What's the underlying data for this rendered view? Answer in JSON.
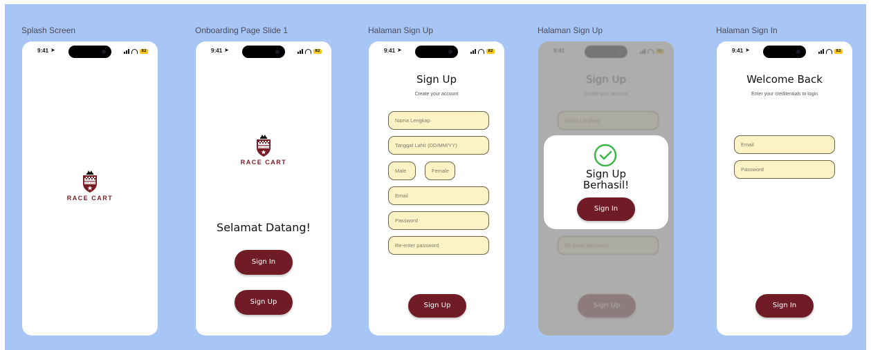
{
  "frames": [
    {
      "label": "Splash Screen"
    },
    {
      "label": "Onboarding Page Slide 1"
    },
    {
      "label": "Halaman Sign Up"
    },
    {
      "label": "Halaman Sign Up"
    },
    {
      "label": "Halaman Sign In"
    }
  ],
  "status_bar": {
    "time": "9:41",
    "battery": "82"
  },
  "logo": {
    "badge_text": "EST.2024",
    "brand": "RACE CART"
  },
  "onboarding": {
    "welcome": "Selamat Datang!",
    "sign_in_label": "Sign In",
    "sign_up_label": "Sign Up"
  },
  "signup": {
    "title": "Sign Up",
    "subtitle": "Create your account",
    "fields": {
      "full_name": "Nama Lengkap",
      "birth_date": "Tanggal Lahir (DD/MM/YY)",
      "male": "Male",
      "female": "Female",
      "email": "Email",
      "password": "Password",
      "reenter_password": "Re-enter password"
    },
    "button_label": "Sign Up"
  },
  "signup_success": {
    "message_line1": "Sign Up",
    "message_line2": "Berhasil!",
    "button_label": "Sign In"
  },
  "signin": {
    "title": "Welcome Back",
    "subtitle": "Enter your creditentials to login",
    "email_placeholder": "Email",
    "password_placeholder": "Password",
    "button_label": "Sign In"
  },
  "colors": {
    "canvas_bg": "#a8c6f5",
    "brand_maroon": "#701c27",
    "field_bg": "#fbf3c6",
    "success_green": "#3cb54a"
  }
}
